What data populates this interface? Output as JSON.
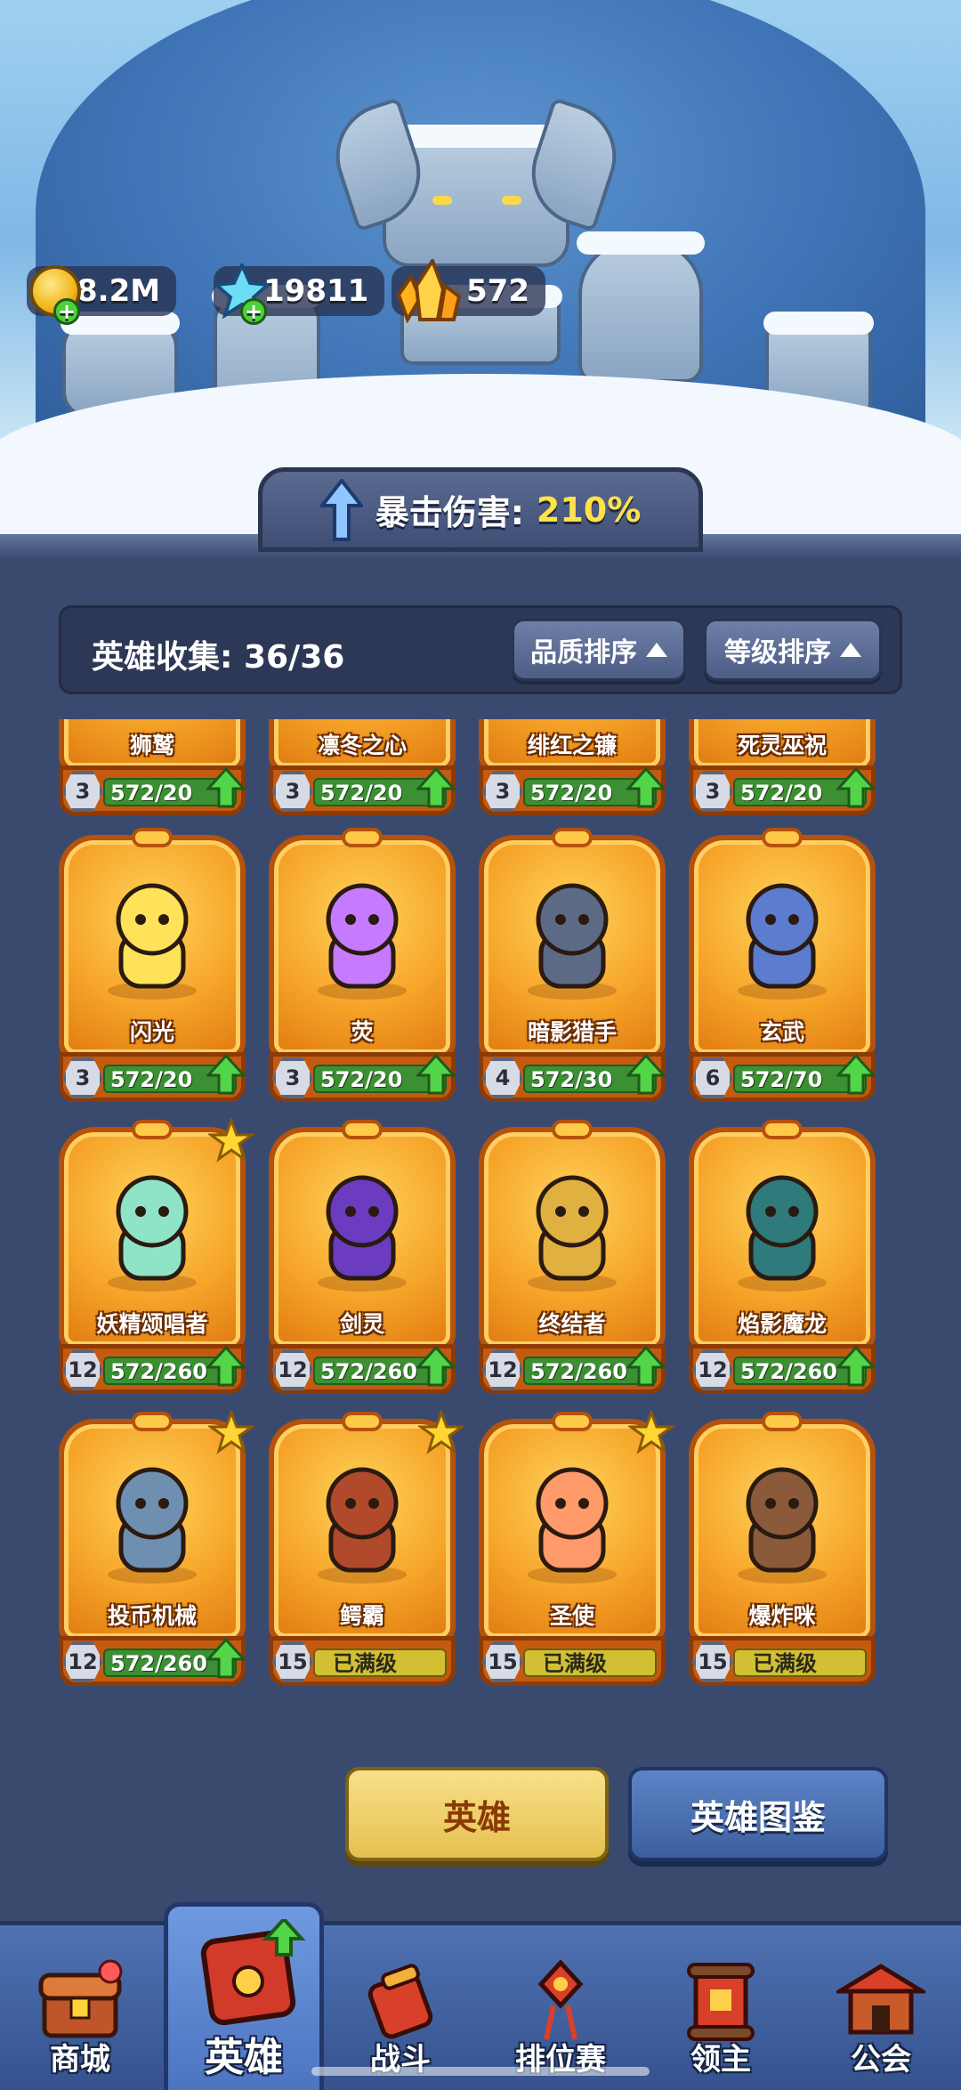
{
  "currency": {
    "gold": "8.2M",
    "diamond": "19811",
    "crystal": "572"
  },
  "crit": {
    "label": "暴击伤害:",
    "value": "210%"
  },
  "collection": {
    "label": "英雄收集:",
    "count": "36/36"
  },
  "sort": {
    "quality": "品质排序",
    "level": "等级排序"
  },
  "heroes_partial_row": [
    {
      "name": "狮鹫",
      "level": "3",
      "progress": "572/20",
      "max": false
    },
    {
      "name": "凛冬之心",
      "level": "3",
      "progress": "572/20",
      "max": false
    },
    {
      "name": "绯红之镰",
      "level": "3",
      "progress": "572/20",
      "max": false
    },
    {
      "name": "死灵巫祝",
      "level": "3",
      "progress": "572/20",
      "max": false
    }
  ],
  "heroes": [
    {
      "name": "闪光",
      "level": "3",
      "progress": "572/20",
      "max": false,
      "star": false
    },
    {
      "name": "荧",
      "level": "3",
      "progress": "572/20",
      "max": false,
      "star": false
    },
    {
      "name": "暗影猎手",
      "level": "4",
      "progress": "572/30",
      "max": false,
      "star": false
    },
    {
      "name": "玄武",
      "level": "6",
      "progress": "572/70",
      "max": false,
      "star": false
    },
    {
      "name": "妖精颂唱者",
      "level": "12",
      "progress": "572/260",
      "max": false,
      "star": true
    },
    {
      "name": "剑灵",
      "level": "12",
      "progress": "572/260",
      "max": false,
      "star": false
    },
    {
      "name": "终结者",
      "level": "12",
      "progress": "572/260",
      "max": false,
      "star": false
    },
    {
      "name": "焰影魔龙",
      "level": "12",
      "progress": "572/260",
      "max": false,
      "star": false
    },
    {
      "name": "投币机械",
      "level": "12",
      "progress": "572/260",
      "max": false,
      "star": true
    },
    {
      "name": "鳄霸",
      "level": "15",
      "progress": "已满级",
      "max": true,
      "star": true
    },
    {
      "name": "圣使",
      "level": "15",
      "progress": "已满级",
      "max": true,
      "star": true
    },
    {
      "name": "爆炸咪",
      "level": "15",
      "progress": "已满级",
      "max": true,
      "star": false
    }
  ],
  "tabs": {
    "hero": "英雄",
    "codex": "英雄图鉴"
  },
  "nav": [
    {
      "label": "商城",
      "icon": "shop-chest-icon",
      "active": false
    },
    {
      "label": "英雄",
      "icon": "hero-cards-icon",
      "active": true
    },
    {
      "label": "战斗",
      "icon": "battle-firecracker-icon",
      "active": false
    },
    {
      "label": "排位赛",
      "icon": "ranked-knot-icon",
      "active": false
    },
    {
      "label": "领主",
      "icon": "lord-scroll-icon",
      "active": false
    },
    {
      "label": "公会",
      "icon": "guild-hall-icon",
      "active": false
    }
  ],
  "colors": {
    "card_orange": "#f6a52a",
    "progress_green": "#3c8f33",
    "maxed_yellow": "#d2c033",
    "crit_yellow": "#ffe24a",
    "nav_blue": "#4f72b3"
  }
}
